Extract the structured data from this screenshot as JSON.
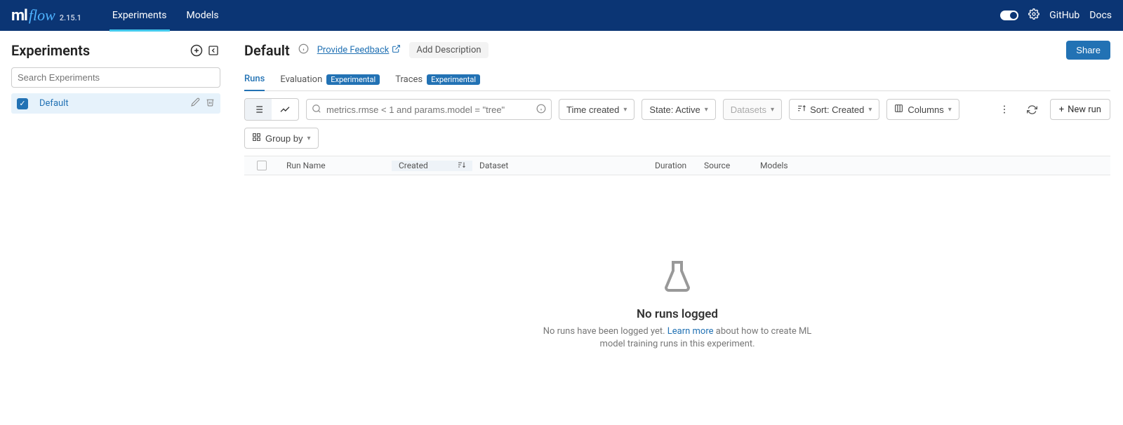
{
  "brand": {
    "ml": "ml",
    "flow": "flow",
    "version": "2.15.1"
  },
  "nav": {
    "experiments": "Experiments",
    "models": "Models"
  },
  "topright": {
    "github": "GitHub",
    "docs": "Docs"
  },
  "sidebar": {
    "title": "Experiments",
    "search_placeholder": "Search Experiments",
    "items": [
      {
        "name": "Default",
        "checked": true
      }
    ]
  },
  "header": {
    "title": "Default",
    "feedback": "Provide Feedback",
    "add_description": "Add Description",
    "share": "Share"
  },
  "tabs": {
    "runs": "Runs",
    "evaluation": "Evaluation",
    "traces": "Traces",
    "badge": "Experimental"
  },
  "toolbar": {
    "search_placeholder": "metrics.rmse < 1 and params.model = \"tree\"",
    "time_created": "Time created",
    "state": "State: Active",
    "datasets": "Datasets",
    "sort": "Sort: Created",
    "columns": "Columns",
    "new_run": "New run",
    "group_by": "Group by"
  },
  "table": {
    "cols": {
      "run": "Run Name",
      "created": "Created",
      "dataset": "Dataset",
      "duration": "Duration",
      "source": "Source",
      "models": "Models"
    }
  },
  "empty": {
    "title": "No runs logged",
    "pre": "No runs have been logged yet. ",
    "link": "Learn more",
    "post": " about how to create ML model training runs in this experiment."
  }
}
